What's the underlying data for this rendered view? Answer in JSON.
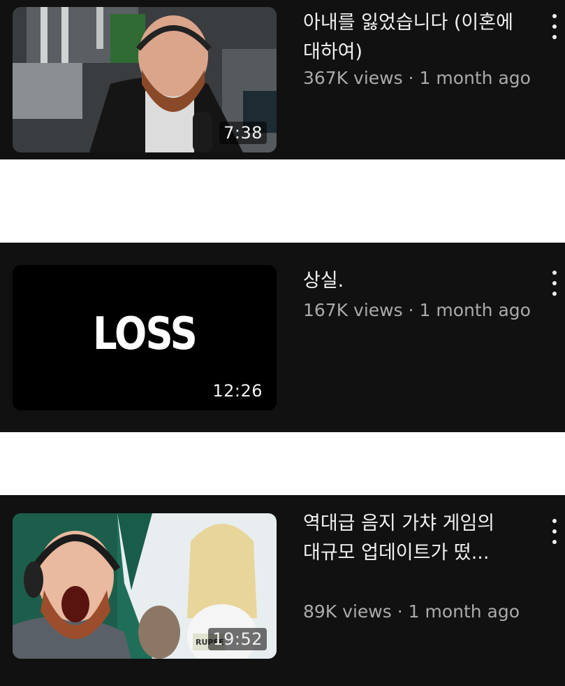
{
  "videos": [
    {
      "title": "아내를 잃었습니다 (이혼에 대하여)",
      "views": "367K views",
      "sep": "·",
      "age": "1 month ago",
      "duration": "7:38"
    },
    {
      "title": "상실.",
      "views": "167K views",
      "sep": "·",
      "age": "1 month ago",
      "duration": "12:26",
      "thumb_text": "LOSS"
    },
    {
      "title": "역대급 음지 가챠 게임의 대규모 업데이트가 떴...",
      "views": "89K views",
      "sep": "·",
      "age": "1 month ago",
      "duration": "19:52",
      "thumb_badge": "RUPEE"
    }
  ],
  "colors": {
    "background": "#111111",
    "title": "#f1f1f1",
    "meta": "#aaaaaa",
    "page": "#ffffff"
  },
  "icons": {
    "more": "kebab-vertical-icon"
  }
}
